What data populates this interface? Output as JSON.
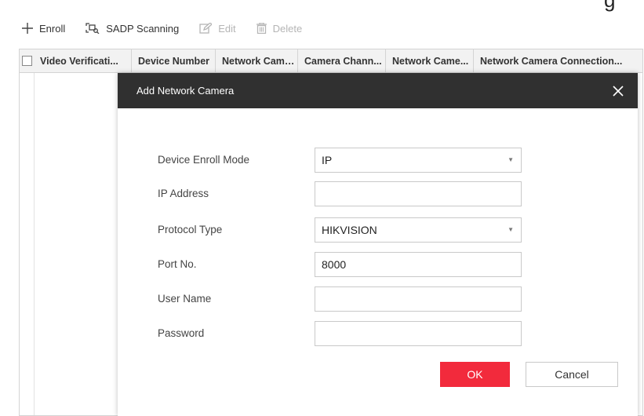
{
  "top_fragment": "g",
  "toolbar": {
    "enroll_label": "Enroll",
    "sadp_label": "SADP Scanning",
    "edit_label": "Edit",
    "delete_label": "Delete"
  },
  "table": {
    "columns": [
      "Video Verificati...",
      "Device Number",
      "Network Came...",
      "Camera Chann...",
      "Network Came...",
      "Network Camera Connection..."
    ]
  },
  "modal": {
    "title": "Add Network Camera",
    "fields": {
      "enroll_mode": {
        "label": "Device Enroll Mode",
        "value": "IP"
      },
      "ip_address": {
        "label": "IP Address",
        "value": ""
      },
      "protocol_type": {
        "label": "Protocol Type",
        "value": "HIKVISION"
      },
      "port_no": {
        "label": "Port No.",
        "value": "8000"
      },
      "user_name": {
        "label": "User Name",
        "value": ""
      },
      "password": {
        "label": "Password",
        "value": ""
      }
    },
    "ok_label": "OK",
    "cancel_label": "Cancel"
  },
  "colors": {
    "modal_header_bg": "#303030",
    "ok_button_bg": "#f22a3c",
    "disabled_text": "#b5b5b5"
  }
}
